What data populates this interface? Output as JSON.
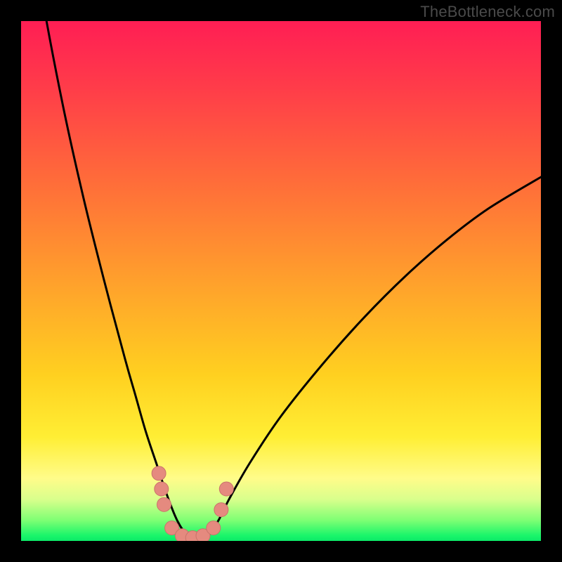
{
  "watermark": "TheBottleneck.com",
  "colors": {
    "background": "#000000",
    "curve": "#000000",
    "dot_fill": "#e58a7f",
    "dot_stroke": "#c9746a"
  },
  "chart_data": {
    "type": "line",
    "title": "",
    "xlabel": "",
    "ylabel": "",
    "xlim": [
      0,
      100
    ],
    "ylim": [
      0,
      100
    ],
    "note": "Bottleneck curve: y≈|mismatch%|; minimum ≈0 around x≈30–36. No axis tick labels rendered.",
    "series": [
      {
        "name": "bottleneck-curve",
        "x": [
          0,
          4,
          8,
          12,
          16,
          20,
          22,
          24,
          26,
          28,
          30,
          32,
          34,
          36,
          38,
          40,
          44,
          50,
          58,
          66,
          74,
          82,
          90,
          100
        ],
        "y": [
          130,
          105,
          84,
          66,
          50,
          35,
          28,
          21,
          15,
          9,
          4,
          1,
          0,
          1,
          4,
          8,
          15,
          24,
          34,
          43,
          51,
          58,
          64,
          70
        ]
      }
    ],
    "points": [
      {
        "x": 26.5,
        "y": 13
      },
      {
        "x": 27.0,
        "y": 10
      },
      {
        "x": 27.5,
        "y": 7
      },
      {
        "x": 29.0,
        "y": 2.5
      },
      {
        "x": 31.0,
        "y": 1.0
      },
      {
        "x": 33.0,
        "y": 0.6
      },
      {
        "x": 35.0,
        "y": 1.0
      },
      {
        "x": 37.0,
        "y": 2.5
      },
      {
        "x": 38.5,
        "y": 6.0
      },
      {
        "x": 39.5,
        "y": 10.0
      }
    ]
  }
}
